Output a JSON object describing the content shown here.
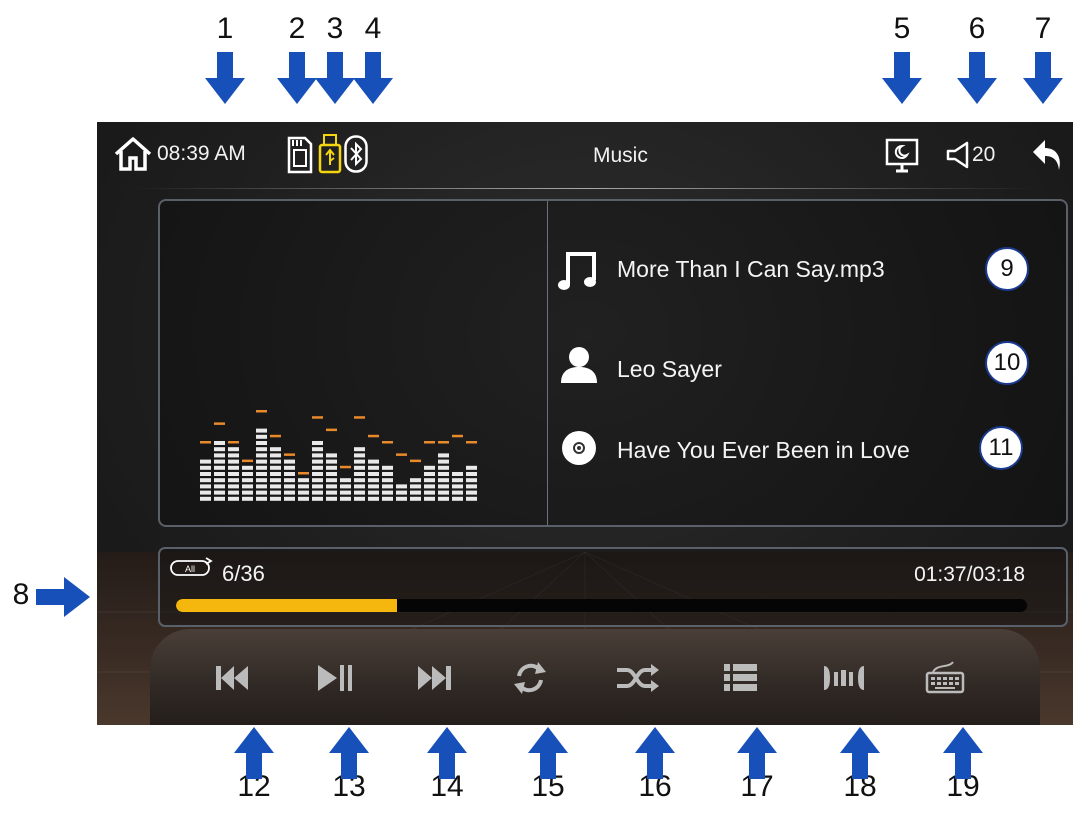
{
  "annotations": {
    "top": [
      "1",
      "2",
      "3",
      "4",
      "5",
      "6",
      "7"
    ],
    "left": "8",
    "bottom": [
      "12",
      "13",
      "14",
      "15",
      "16",
      "17",
      "18",
      "19"
    ]
  },
  "statusbar": {
    "time": "08:39 AM",
    "title": "Music",
    "volume": "20",
    "icons": [
      "home-icon",
      "sd-card-icon",
      "usb-icon",
      "bluetooth-icon",
      "display-mode-icon",
      "volume-icon",
      "back-icon"
    ]
  },
  "track": {
    "song": "More Than I Can Say.mp3",
    "artist": "Leo Sayer",
    "album": "Have You Ever Been in Love",
    "badges": [
      "9",
      "10",
      "11"
    ]
  },
  "progress": {
    "repeat_label": "All",
    "index": "6/36",
    "time": "01:37/03:18",
    "fraction": 0.26
  },
  "controls": [
    "previous",
    "play-pause",
    "next",
    "repeat",
    "shuffle",
    "playlist",
    "equalizer",
    "keyboard"
  ],
  "equalizer": {
    "bars": [
      7,
      10,
      9,
      6,
      12,
      9,
      7,
      4,
      10,
      8,
      4,
      9,
      7,
      6,
      3,
      4,
      6,
      8,
      5,
      6
    ],
    "peaks": [
      10,
      13,
      10,
      7,
      15,
      11,
      8,
      5,
      14,
      12,
      6,
      14,
      11,
      10,
      8,
      7,
      10,
      10,
      11,
      10
    ]
  },
  "colors": {
    "accent": "#f5b70d",
    "peak": "#e8892a",
    "badge_border": "#1a3a8f",
    "arrow": "#1650b8"
  }
}
